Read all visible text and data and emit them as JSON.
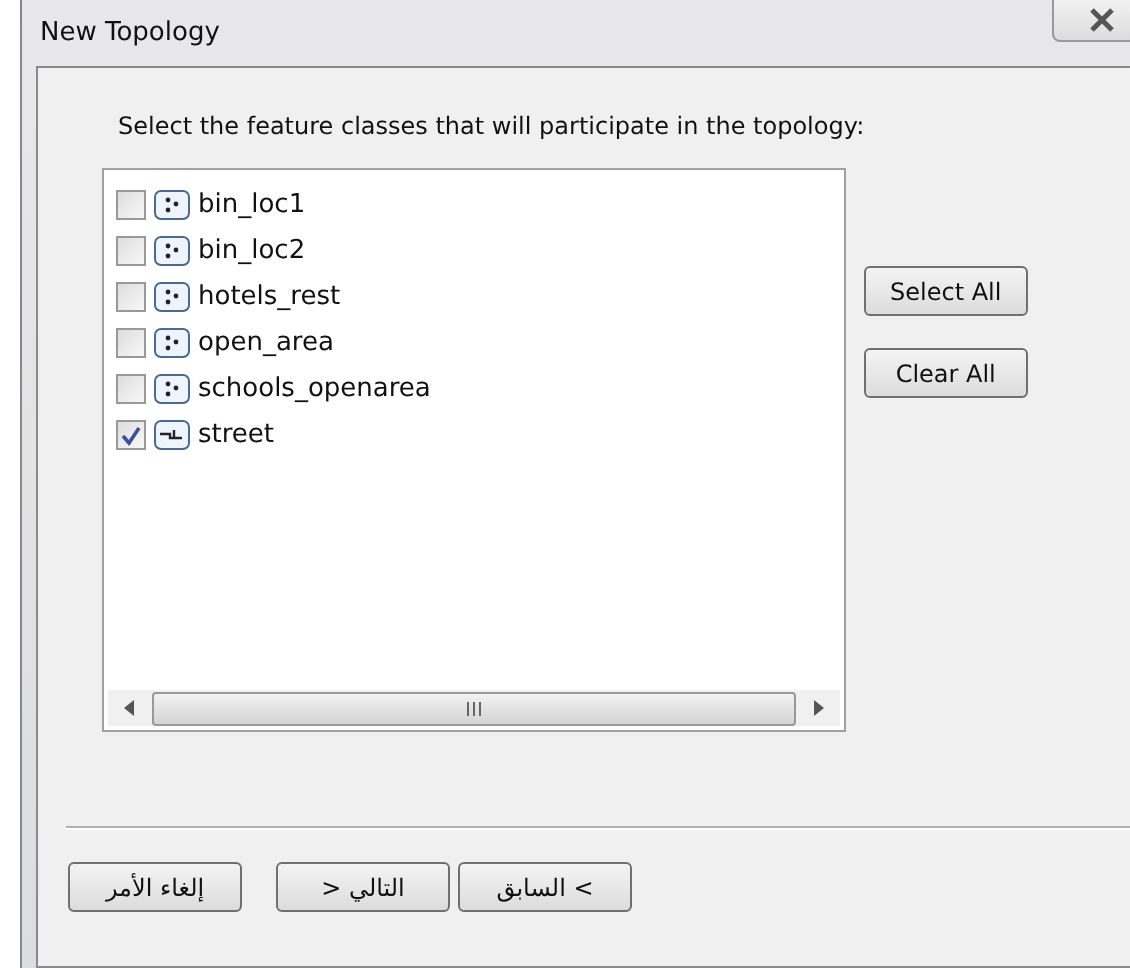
{
  "window": {
    "title": "New Topology"
  },
  "instruction": "Select the feature classes that will participate in the topology:",
  "feature_classes": [
    {
      "name": "bin_loc1",
      "kind": "point",
      "checked": false
    },
    {
      "name": "bin_loc2",
      "kind": "point",
      "checked": false
    },
    {
      "name": "hotels_rest",
      "kind": "point",
      "checked": false
    },
    {
      "name": "open_area",
      "kind": "point",
      "checked": false
    },
    {
      "name": "schools_openarea",
      "kind": "point",
      "checked": false
    },
    {
      "name": "street",
      "kind": "line",
      "checked": true
    }
  ],
  "side_buttons": [
    "Select All",
    "Clear All"
  ],
  "footer_buttons": [
    "السابق <",
    "> التالي",
    "إلغاء الأمر"
  ]
}
